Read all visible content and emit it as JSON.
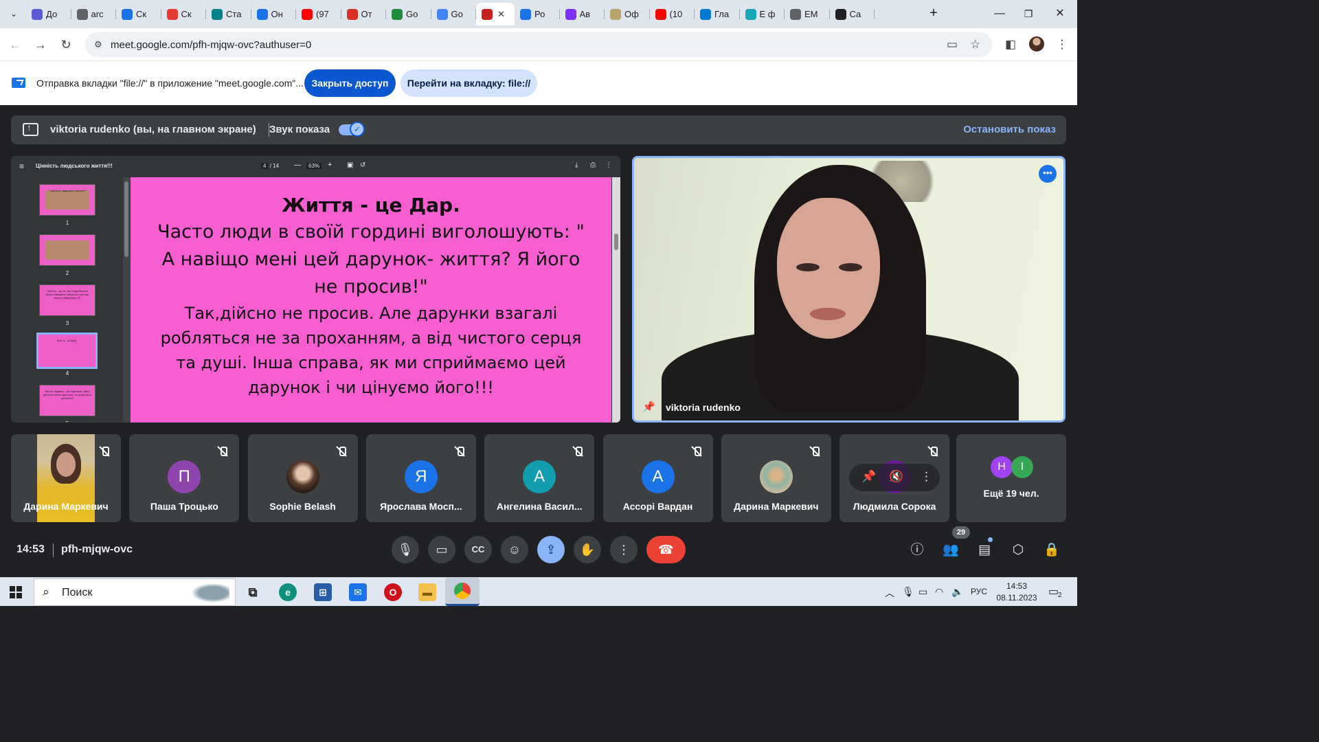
{
  "browser": {
    "tabs": [
      {
        "label": "До",
        "icon": "shield-icon",
        "color": "#5b5bd6"
      },
      {
        "label": "arc",
        "icon": "globe-icon",
        "color": "#5f6368"
      },
      {
        "label": "Ск",
        "icon": "heart-icon",
        "color": "#1a73e8"
      },
      {
        "label": "Ск",
        "icon": "heart-icon",
        "color": "#e53935"
      },
      {
        "label": "Ста",
        "icon": "sway-icon",
        "color": "#038387"
      },
      {
        "label": "Он",
        "icon": "target-icon",
        "color": "#1a73e8"
      },
      {
        "label": "(97",
        "icon": "youtube-icon",
        "color": "#ff0000"
      },
      {
        "label": "От",
        "icon": "gmail-icon",
        "color": "#d93025"
      },
      {
        "label": "Go",
        "icon": "classroom-icon",
        "color": "#1e8e3e"
      },
      {
        "label": "Go",
        "icon": "forms-icon",
        "color": "#4285f4"
      },
      {
        "label": "",
        "icon": "record-icon",
        "color": "#c5221f",
        "active": true
      },
      {
        "label": "Ро",
        "icon": "target-icon",
        "color": "#1a73e8"
      },
      {
        "label": "Ав",
        "icon": "viber-icon",
        "color": "#7b2ff7"
      },
      {
        "label": "Оф",
        "icon": "crest-icon",
        "color": "#b8a36b"
      },
      {
        "label": "(10",
        "icon": "youtube-icon",
        "color": "#ff0000"
      },
      {
        "label": "Гла",
        "icon": "edge-icon",
        "color": "#0078d4"
      },
      {
        "label": "Е ф",
        "icon": "ai-icon",
        "color": "#1aa6b7"
      },
      {
        "label": "ЕМ",
        "icon": "document-icon",
        "color": "#5f6368"
      },
      {
        "label": "Са",
        "icon": "wikipedia-icon",
        "color": "#202124"
      }
    ],
    "active_tab_close": "✕",
    "url": "meet.google.com/pfh-mjqw-ovc?authuser=0"
  },
  "infobar": {
    "text": "Отправка вкладки \"file://\" в приложение \"meet.google.com\"...",
    "stop_button": "Закрыть доступ",
    "goto_button": "Перейти на вкладку: file://"
  },
  "presentation": {
    "presenter": "viktoria rudenko (вы, на главном экране)",
    "sound_label": "Звук показа",
    "sound_on": true,
    "stop_label": "Остановить показ"
  },
  "pdf": {
    "title": "Цінність людського життя!!!",
    "page_current": "4",
    "page_total": "/ 14",
    "zoom": "63%",
    "thumbs": [
      {
        "num": "1",
        "text": "\" Цінність людського життя!!!\""
      },
      {
        "num": "2",
        "text": ""
      },
      {
        "num": "3",
        "text": "\"Життя – це те, що люди більше всього бажають зберегти і менше всього оберігають !!!\""
      },
      {
        "num": "4",
        "text": "Життя - це Дар."
      },
      {
        "num": "5",
        "text": "Життя людини – не повторне, воно дається лише один раз і в цьому його цінність!!!"
      }
    ],
    "slide": {
      "heading": "Життя - це Дар.",
      "para1": "Часто люди в своїй гордині виголошують: \" А навіщо мені цей дарунок- життя? Я його не просив!\"",
      "para2": "Так,дійсно не просив. Але дарунки взагалі робляться не за проханням, а від чистого серця та душі. Інша справа, як ми сприймаємо цей дарунок і чи цінуємо його!!!"
    }
  },
  "main_video": {
    "name": "viktoria rudenko"
  },
  "participants": [
    {
      "name": "Дарина Маркевич",
      "type": "photo-yellow"
    },
    {
      "name": "Паша Троцько",
      "initial": "П",
      "color": "#8e44ad"
    },
    {
      "name": "Sophie Belash",
      "type": "photo-sophie"
    },
    {
      "name": "Ярослава Мосп...",
      "initial": "Я",
      "color": "#1a73e8"
    },
    {
      "name": "Ангелина Васил...",
      "initial": "А",
      "color": "#129eaf"
    },
    {
      "name": "Ассорі Вардан",
      "initial": "А",
      "color": "#1a73e8"
    },
    {
      "name": "Дарина Маркевич",
      "type": "photo-small"
    },
    {
      "name": "Людмила Сорока",
      "initial": "Л",
      "color": "#6a1b9a"
    }
  ],
  "more_tile": {
    "text": "Ещё 19 чел.",
    "avatars": [
      {
        "initial": "Н",
        "color": "#a142f4"
      },
      {
        "initial": "І",
        "color": "#34a853"
      }
    ]
  },
  "controls": {
    "time": "14:53",
    "meeting_code": "pfh-mjqw-ovc",
    "people_count": "29"
  },
  "taskbar": {
    "search_placeholder": "Поиск",
    "lang": "РУС",
    "time": "14:53",
    "date": "08.11.2023",
    "notifications": "2"
  }
}
